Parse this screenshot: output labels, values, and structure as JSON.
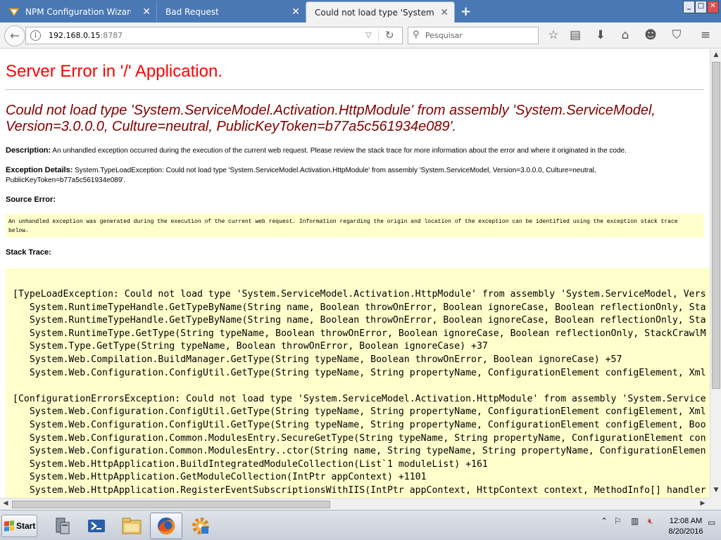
{
  "browser": {
    "tabs": [
      {
        "label": "NPM Configuration Wizard pr...",
        "close": "✕"
      },
      {
        "label": "Bad Request",
        "close": "✕"
      },
      {
        "label": "Could not load type 'System.Servi...",
        "close": "✕"
      }
    ],
    "new_tab": "+",
    "window_controls": [
      "_",
      "□",
      "✕"
    ],
    "url_host": "192.168.0.15",
    "url_port": ":8787",
    "search_placeholder": "Pesquisar",
    "toolbar_icons": [
      "bookmark-star-icon",
      "reading-list-icon",
      "download-icon",
      "home-icon",
      "smiley-icon",
      "pocket-icon",
      "menu-icon"
    ]
  },
  "page": {
    "title": "Server Error in '/' Application.",
    "error_message": "Could not load type 'System.ServiceModel.Activation.HttpModule' from assembly 'System.ServiceModel, Version=3.0.0.0, Culture=neutral, PublicKeyToken=b77a5c561934e089'.",
    "description_label": "Description:",
    "description_text": "An unhandled exception occurred during the execution of the current web request. Please review the stack trace for more information about the error and where it originated in the code.",
    "exception_label": "Exception Details:",
    "exception_text": "System.TypeLoadException: Could not load type 'System.ServiceModel.Activation.HttpModule' from assembly 'System.ServiceModel, Version=3.0.0.0, Culture=neutral, PublicKeyToken=b77a5c561934e089'.",
    "source_error_label": "Source Error:",
    "source_error_text": "An unhandled exception was generated during the execution of the current web request. Information regarding the origin and location of the exception can be identified using the exception stack trace below.",
    "stack_trace_label": "Stack Trace:",
    "stack_trace": "[TypeLoadException: Could not load type 'System.ServiceModel.Activation.HttpModule' from assembly 'System.ServiceModel, Vers\n   System.RuntimeTypeHandle.GetTypeByName(String name, Boolean throwOnError, Boolean ignoreCase, Boolean reflectionOnly, Sta\n   System.RuntimeTypeHandle.GetTypeByName(String name, Boolean throwOnError, Boolean ignoreCase, Boolean reflectionOnly, Sta\n   System.RuntimeType.GetType(String typeName, Boolean throwOnError, Boolean ignoreCase, Boolean reflectionOnly, StackCrawlM\n   System.Type.GetType(String typeName, Boolean throwOnError, Boolean ignoreCase) +37\n   System.Web.Compilation.BuildManager.GetType(String typeName, Boolean throwOnError, Boolean ignoreCase) +57\n   System.Web.Configuration.ConfigUtil.GetType(String typeName, String propertyName, ConfigurationElement configElement, Xml\n\n[ConfigurationErrorsException: Could not load type 'System.ServiceModel.Activation.HttpModule' from assembly 'System.Service\n   System.Web.Configuration.ConfigUtil.GetType(String typeName, String propertyName, ConfigurationElement configElement, Xml\n   System.Web.Configuration.ConfigUtil.GetType(String typeName, String propertyName, ConfigurationElement configElement, Boo\n   System.Web.Configuration.Common.ModulesEntry.SecureGetType(String typeName, String propertyName, ConfigurationElement con\n   System.Web.Configuration.Common.ModulesEntry..ctor(String name, String typeName, String propertyName, ConfigurationElemen\n   System.Web.HttpApplication.BuildIntegratedModuleCollection(List`1 moduleList) +161\n   System.Web.HttpApplication.GetModuleCollection(IntPtr appContext) +1101\n   System.Web.HttpApplication.RegisterEventSubscriptionsWithIIS(IntPtr appContext, HttpContext context, MethodInfo[] handler"
  },
  "taskbar": {
    "start_label": "Start",
    "apps": [
      "server-manager-icon",
      "powershell-icon",
      "file-explorer-icon",
      "firefox-icon",
      "settings-gear-icon"
    ],
    "time": "12:08 AM",
    "date": "8/20/2016"
  }
}
